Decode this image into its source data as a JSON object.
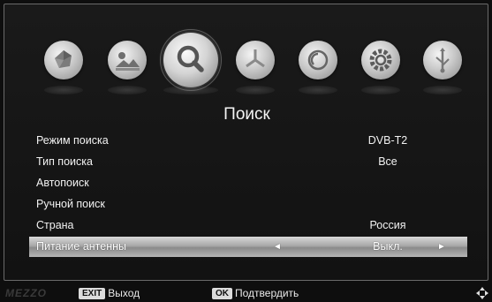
{
  "menu": {
    "icons": [
      {
        "name": "picture-icon"
      },
      {
        "name": "image-icon"
      },
      {
        "name": "search-icon"
      },
      {
        "name": "time-icon"
      },
      {
        "name": "option-icon"
      },
      {
        "name": "settings-icon"
      },
      {
        "name": "usb-icon"
      }
    ],
    "active_index": 2
  },
  "page_title": "Поиск",
  "rows": [
    {
      "label": "Режим поиска",
      "value": "DVB-T2"
    },
    {
      "label": "Тип поиска",
      "value": "Все"
    },
    {
      "label": "Автопоиск",
      "value": ""
    },
    {
      "label": "Ручной поиск",
      "value": ""
    },
    {
      "label": "Страна",
      "value": "Россия"
    },
    {
      "label": "Питание антенны",
      "value": "Выкл."
    }
  ],
  "selected_row": 5,
  "arrows": {
    "left": "◄",
    "right": "►"
  },
  "footer": {
    "brand": "MEZZO",
    "exit_key": "EXIT",
    "exit_label": "Выход",
    "ok_key": "OK",
    "ok_label": "Подтвердить"
  }
}
